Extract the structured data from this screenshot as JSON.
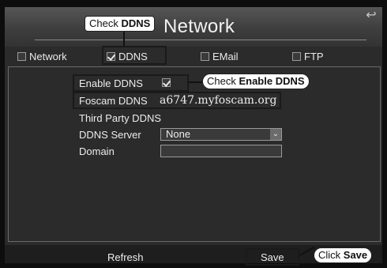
{
  "window": {
    "title": "Network",
    "back_icon": "back-arrow-icon"
  },
  "tabs": [
    {
      "label": "Network",
      "checked": false
    },
    {
      "label": "DDNS",
      "checked": true
    },
    {
      "label": "EMail",
      "checked": false
    },
    {
      "label": "FTP",
      "checked": false
    }
  ],
  "form": {
    "enable_ddns": {
      "label": "Enable DDNS",
      "checked": true
    },
    "foscam_ddns": {
      "label": "Foscam DDNS",
      "value": "a6747.myfoscam.org"
    },
    "third_party": {
      "label": "Third Party DDNS"
    },
    "ddns_server": {
      "label": "DDNS Server",
      "selected": "None"
    },
    "domain": {
      "label": "Domain",
      "value": ""
    }
  },
  "buttons": {
    "refresh": "Refresh",
    "save": "Save"
  },
  "annotations": {
    "check_ddns": {
      "prefix": "Check ",
      "bold": "DDNS"
    },
    "check_enable": {
      "prefix": "Check ",
      "bold": "Enable DDNS"
    },
    "click_save": {
      "prefix": "Click ",
      "bold": "Save"
    }
  }
}
